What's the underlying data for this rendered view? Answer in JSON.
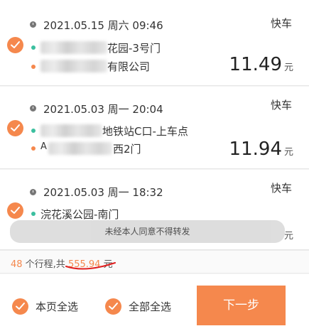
{
  "trips": [
    {
      "datetime": "2021.05.15 周六 09:46",
      "type": "快车",
      "start_visible": "花园-3号门",
      "end_visible": "有限公司",
      "price": "11.49",
      "unit": "元"
    },
    {
      "datetime": "2021.05.03 周一 20:04",
      "type": "快车",
      "start_visible": "地铁站C口-上车点",
      "end_prefix": "A",
      "end_visible": "西2门",
      "price": "11.94",
      "unit": "元"
    },
    {
      "datetime": "2021.05.03 周一 18:32",
      "type": "快车",
      "start_visible": "浣花溪公园-南门",
      "unit": "元"
    }
  ],
  "toast": "未经本人同意不得转发",
  "summary": {
    "count": "48",
    "text_mid": " 个行程,共 ",
    "total": "555.94",
    "unit": " 元"
  },
  "footer": {
    "select_page": "本页全选",
    "select_all": "全部全选",
    "next": "下一步"
  },
  "colors": {
    "accent": "#f5884d",
    "start_dot": "#3bbf9f",
    "annotation": "#e02020"
  }
}
